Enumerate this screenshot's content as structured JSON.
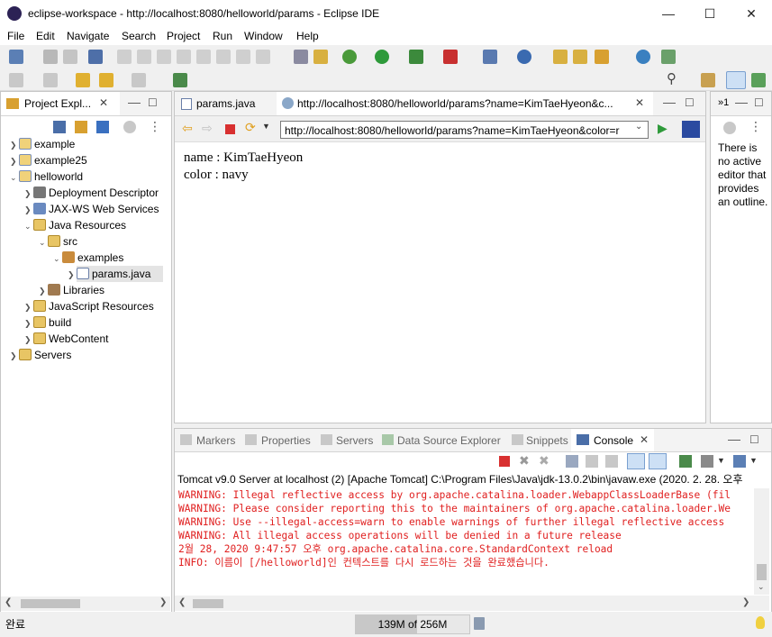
{
  "window": {
    "title": "eclipse-workspace - http://localhost:8080/helloworld/params - Eclipse IDE"
  },
  "menu": [
    "File",
    "Edit",
    "Navigate",
    "Search",
    "Project",
    "Run",
    "Window",
    "Help"
  ],
  "explorer": {
    "tab": "Project Expl...",
    "tree": [
      {
        "label": "example"
      },
      {
        "label": "example25"
      },
      {
        "label": "helloworld"
      },
      {
        "label": "Deployment Descriptor"
      },
      {
        "label": "JAX-WS Web Services"
      },
      {
        "label": "Java Resources"
      },
      {
        "label": "src"
      },
      {
        "label": "examples"
      },
      {
        "label": "params.java"
      },
      {
        "label": "Libraries"
      },
      {
        "label": "JavaScript Resources"
      },
      {
        "label": "build"
      },
      {
        "label": "WebContent"
      },
      {
        "label": "Servers"
      }
    ]
  },
  "editor": {
    "tab1": "params.java",
    "tab2": "http://localhost:8080/helloworld/params?name=KimTaeHyeon&c...",
    "url": "http://localhost:8080/helloworld/params?name=KimTaeHyeon&color=r",
    "content": [
      "name : KimTaeHyeon",
      "color : navy"
    ]
  },
  "outline": {
    "tab": "»1",
    "message": "There is no active editor that provides an outline."
  },
  "bottom": {
    "tabs": [
      "Markers",
      "Properties",
      "Servers",
      "Data Source Explorer",
      "Snippets",
      "Console"
    ],
    "console_header": "Tomcat v9.0 Server at localhost (2) [Apache Tomcat] C:\\Program Files\\Java\\jdk-13.0.2\\bin\\javaw.exe (2020. 2. 28. 오후",
    "lines": [
      "WARNING: Illegal reflective access by org.apache.catalina.loader.WebappClassLoaderBase (fil",
      "WARNING: Please consider reporting this to the maintainers of org.apache.catalina.loader.We",
      "WARNING: Use --illegal-access=warn to enable warnings of further illegal reflective access",
      "WARNING: All illegal access operations will be denied in a future release",
      "2월 28, 2020 9:47:57 오후 org.apache.catalina.core.StandardContext reload",
      "INFO: 이름이 [/helloworld]인 컨텍스트를 다시 로드하는 것을 완료했습니다."
    ]
  },
  "status": {
    "left": "완료",
    "heap": "139M of 256M"
  },
  "colors": {
    "console_text": "#e02020",
    "heap_bar": "#c8c8c8"
  }
}
